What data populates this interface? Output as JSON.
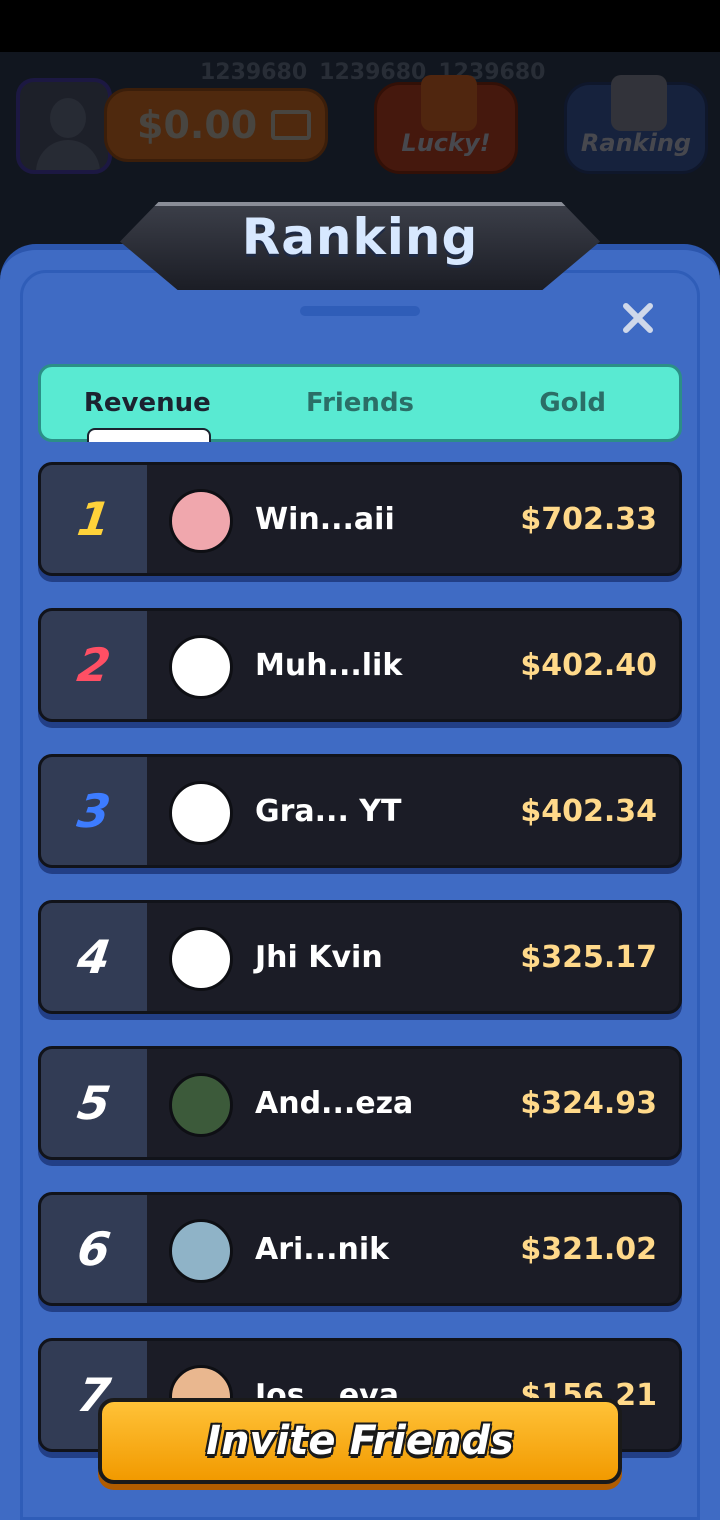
{
  "header": {
    "scores": [
      "1239680",
      "1239680",
      "1239680"
    ],
    "balance": "$0.00",
    "lucky_label": "Lucky!",
    "ranking_label": "Ranking"
  },
  "modal": {
    "title": "Ranking",
    "tabs": [
      {
        "label": "Revenue",
        "active": true
      },
      {
        "label": "Friends",
        "active": false
      },
      {
        "label": "Gold",
        "active": false
      }
    ],
    "rows": [
      {
        "rank": "1",
        "name": "Win...aii",
        "amount": "$702.33",
        "rank_color": "#ffd23a"
      },
      {
        "rank": "2",
        "name": "Muh...lik",
        "amount": "$402.40",
        "rank_color": "#ff4f64"
      },
      {
        "rank": "3",
        "name": "Gra... YT",
        "amount": "$402.34",
        "rank_color": "#3d7cff"
      },
      {
        "rank": "4",
        "name": "Jhi Kvin",
        "amount": "$325.17",
        "rank_color": "#ffffff"
      },
      {
        "rank": "5",
        "name": "And...eza",
        "amount": "$324.93",
        "rank_color": "#ffffff"
      },
      {
        "rank": "6",
        "name": "Ari...nik",
        "amount": "$321.02",
        "rank_color": "#ffffff"
      },
      {
        "rank": "7",
        "name": "Jos...eva",
        "amount": "$156.21",
        "rank_color": "#ffffff"
      }
    ],
    "invite_button": "Invite Friends"
  },
  "colors": {
    "frame_blue": "#3f6bc4",
    "tab_teal": "#59ead2",
    "amount_gold": "#ffd98a",
    "button_orange": "#f29a00"
  },
  "icons": [
    "avatar-placeholder-icon",
    "wallet-icon",
    "gift-icon",
    "podium-icon",
    "close-icon"
  ]
}
